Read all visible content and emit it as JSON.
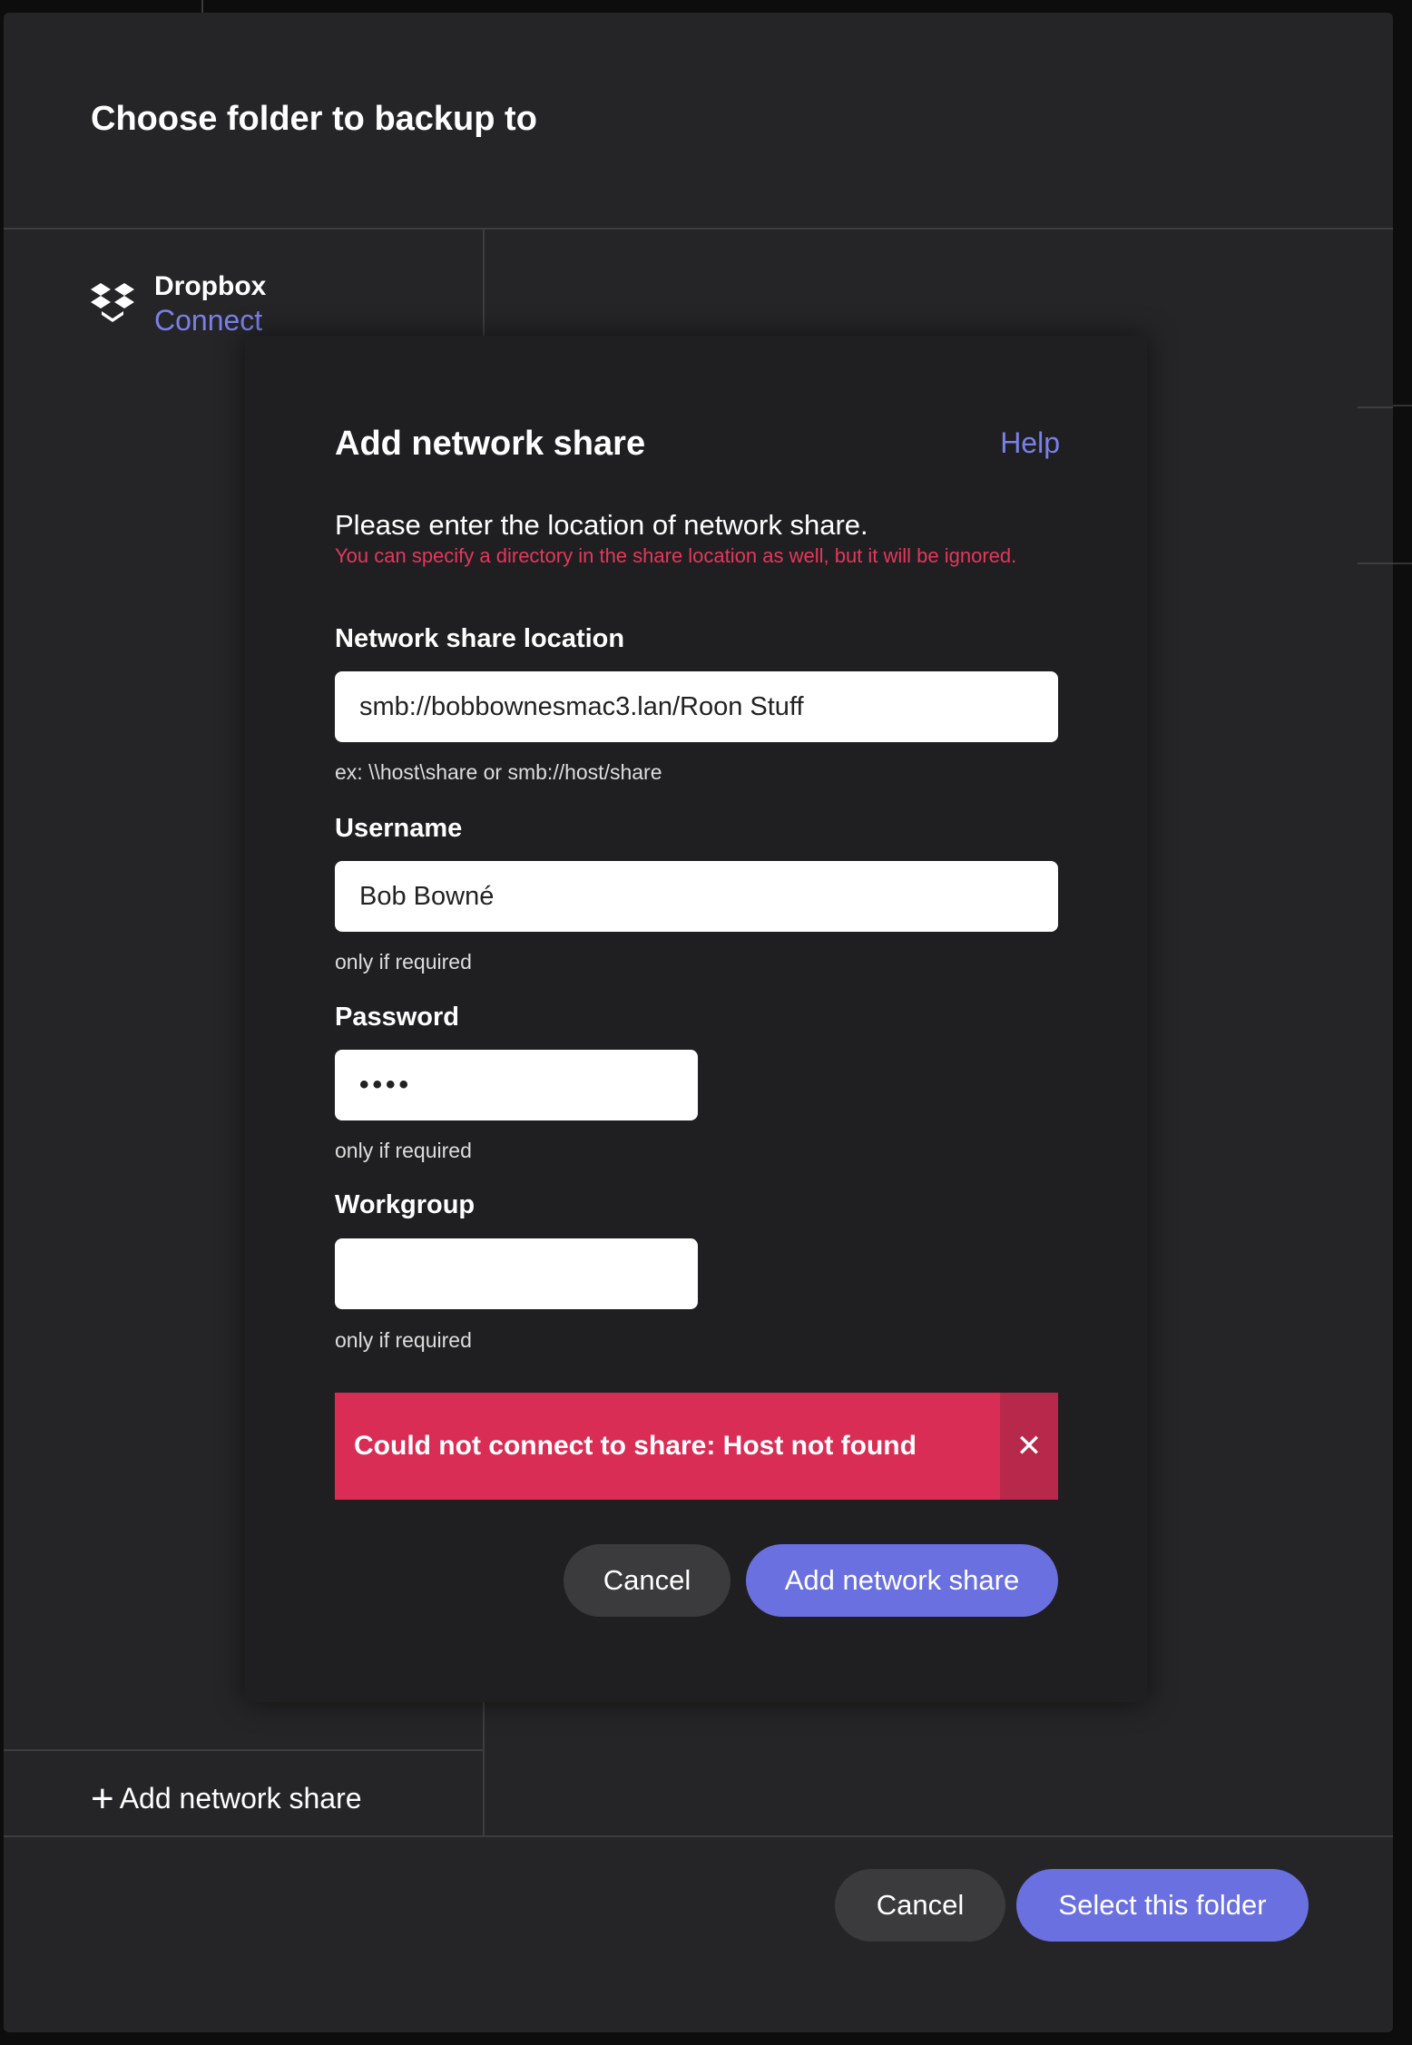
{
  "outer_dialog": {
    "title": "Choose folder to backup to",
    "dropbox": {
      "name": "Dropbox",
      "action": "Connect"
    },
    "add_share_link": "Add network share",
    "cancel_label": "Cancel",
    "select_label": "Select this folder"
  },
  "modal": {
    "title": "Add network share",
    "help": "Help",
    "intro": "Please enter the location of network share.",
    "warning": "You can specify a directory in the share location as well, but it will be ignored.",
    "location": {
      "label": "Network share location",
      "value": "smb://bobbownesmac3.lan/Roon Stuff",
      "hint": "ex: \\\\host\\share or smb://host/share"
    },
    "username": {
      "label": "Username",
      "value": "Bob Bowné",
      "hint": "only if required"
    },
    "password": {
      "label": "Password",
      "value": "••••",
      "hint": "only if required"
    },
    "workgroup": {
      "label": "Workgroup",
      "value": "",
      "hint": "only if required"
    },
    "error": "Could not connect to share: Host not found",
    "cancel_label": "Cancel",
    "submit_label": "Add network share"
  },
  "colors": {
    "accent": "#6a70e0",
    "error": "#d92d55",
    "warning_text": "#e3385c",
    "dialog_bg": "#252527",
    "modal_bg": "#1f1f21"
  },
  "icons": [
    "dropbox-icon",
    "plus-icon",
    "close-icon"
  ]
}
